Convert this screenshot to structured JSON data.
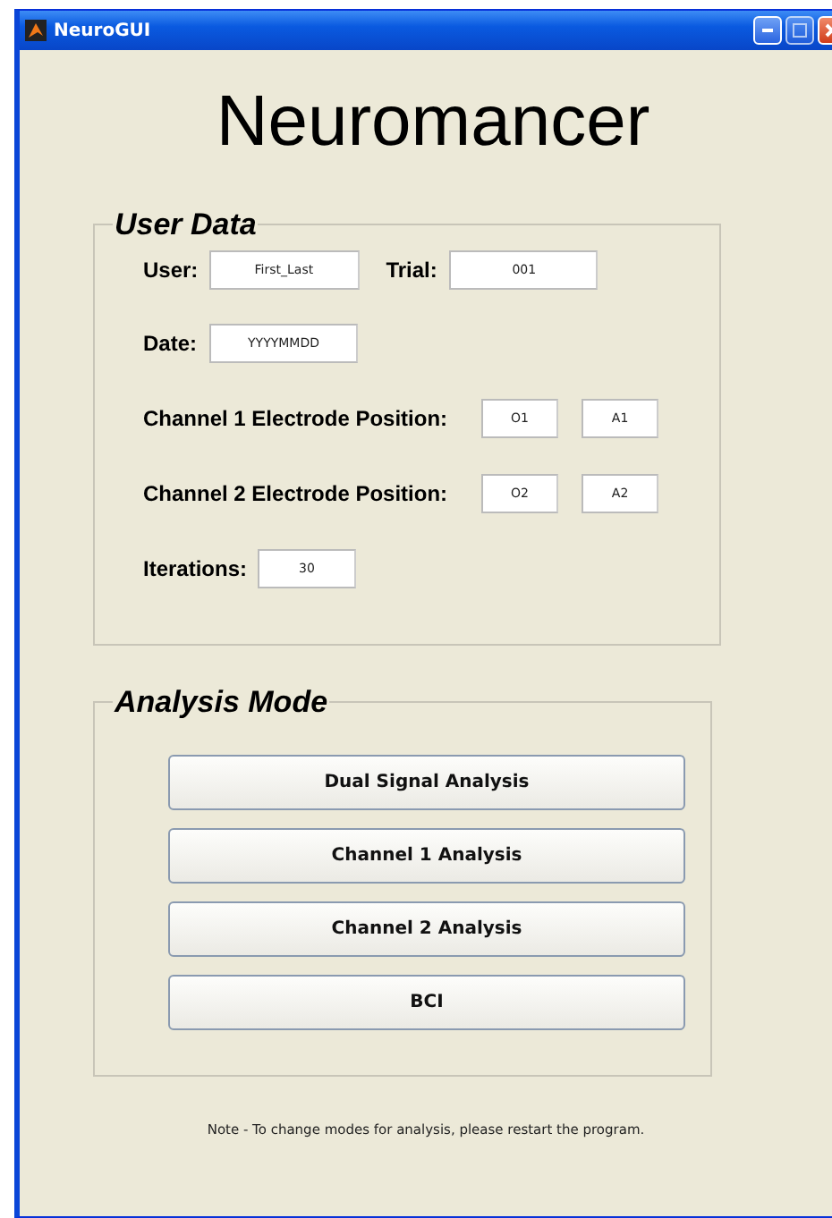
{
  "window": {
    "title": "NeuroGUI"
  },
  "heading": "Neuromancer",
  "user_data": {
    "title": "User Data",
    "user": {
      "label": "User:",
      "value": "First_Last"
    },
    "trial": {
      "label": "Trial:",
      "value": "001"
    },
    "date": {
      "label": "Date:",
      "value": "YYYYMMDD"
    },
    "channel_1": {
      "label": "Channel 1 Electrode Position:",
      "values": [
        "O1",
        "A1"
      ]
    },
    "channel_2": {
      "label": "Channel 2 Electrode Position:",
      "values": [
        "O2",
        "A2"
      ]
    },
    "iterations": {
      "label": "Iterations:",
      "value": "30"
    }
  },
  "analysis_mode": {
    "title": "Analysis Mode",
    "buttons": [
      "Dual Signal Analysis",
      "Channel 1 Analysis",
      "Channel 2 Analysis",
      "BCI"
    ]
  },
  "note": "Note - To change modes for analysis, please restart the program."
}
